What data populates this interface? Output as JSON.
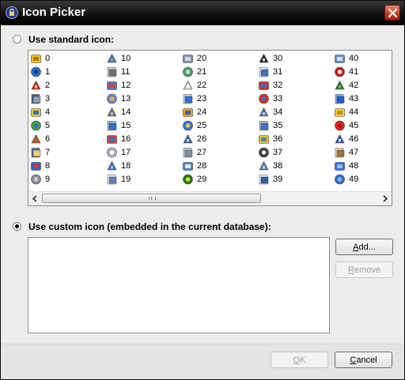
{
  "window": {
    "title": "Icon Picker"
  },
  "options": {
    "standard": {
      "label": "Use standard icon:",
      "selected": false
    },
    "custom": {
      "label": "Use custom icon (embedded in the current database):",
      "selected": true
    }
  },
  "icons": [
    {
      "n": "0",
      "icon": "key-icon"
    },
    {
      "n": "1",
      "icon": "globe-icon"
    },
    {
      "n": "2",
      "icon": "warning-icon"
    },
    {
      "n": "3",
      "icon": "server-icon"
    },
    {
      "n": "4",
      "icon": "note-icon"
    },
    {
      "n": "5",
      "icon": "users-icon"
    },
    {
      "n": "6",
      "icon": "blocks-icon"
    },
    {
      "n": "7",
      "icon": "edit-icon"
    },
    {
      "n": "8",
      "icon": "network-globe-icon"
    },
    {
      "n": "9",
      "icon": "id-card-icon"
    },
    {
      "n": "10",
      "icon": "email-icon"
    },
    {
      "n": "11",
      "icon": "camera-icon"
    },
    {
      "n": "12",
      "icon": "antenna-icon"
    },
    {
      "n": "13",
      "icon": "keys-icon"
    },
    {
      "n": "14",
      "icon": "plug-icon"
    },
    {
      "n": "15",
      "icon": "scanner-icon"
    },
    {
      "n": "16",
      "icon": "star-globe-icon"
    },
    {
      "n": "17",
      "icon": "cd-icon"
    },
    {
      "n": "18",
      "icon": "monitor-icon"
    },
    {
      "n": "19",
      "icon": "envelope-open-icon"
    },
    {
      "n": "20",
      "icon": "gear-icon"
    },
    {
      "n": "21",
      "icon": "clipboard-icon"
    },
    {
      "n": "22",
      "icon": "document-icon"
    },
    {
      "n": "23",
      "icon": "window-icon"
    },
    {
      "n": "24",
      "icon": "lightning-icon"
    },
    {
      "n": "25",
      "icon": "folder-mail-icon"
    },
    {
      "n": "26",
      "icon": "floppy-icon"
    },
    {
      "n": "27",
      "icon": "drive-icon"
    },
    {
      "n": "28",
      "icon": "picture-icon"
    },
    {
      "n": "29",
      "icon": "terminal-green-icon"
    },
    {
      "n": "30",
      "icon": "console-icon"
    },
    {
      "n": "31",
      "icon": "printer-icon"
    },
    {
      "n": "32",
      "icon": "grid-icon"
    },
    {
      "n": "33",
      "icon": "checklist-icon"
    },
    {
      "n": "34",
      "icon": "wrench-icon"
    },
    {
      "n": "35",
      "icon": "computer-network-icon"
    },
    {
      "n": "36",
      "icon": "archive-icon"
    },
    {
      "n": "37",
      "icon": "percent-icon"
    },
    {
      "n": "38",
      "icon": "people-network-icon"
    },
    {
      "n": "39",
      "icon": "clock-icon"
    },
    {
      "n": "40",
      "icon": "search-icon"
    },
    {
      "n": "41",
      "icon": "calendar-icon"
    },
    {
      "n": "42",
      "icon": "chip-icon"
    },
    {
      "n": "43",
      "icon": "database-icon"
    },
    {
      "n": "44",
      "icon": "folder-icon"
    },
    {
      "n": "45",
      "icon": "delete-icon"
    },
    {
      "n": "46",
      "icon": "help-icon"
    },
    {
      "n": "47",
      "icon": "package-icon"
    },
    {
      "n": "48",
      "icon": "folder-open-icon"
    },
    {
      "n": "49",
      "icon": "folder-open-icon"
    }
  ],
  "buttons": {
    "add": "Add...",
    "remove": "Remove",
    "ok": "OK",
    "cancel": "Cancel"
  },
  "colors": {
    "titlebar": "#1a1a1a",
    "close": "#c53a1c",
    "dialog": "#ececec",
    "footer": "#e4e4e4"
  }
}
